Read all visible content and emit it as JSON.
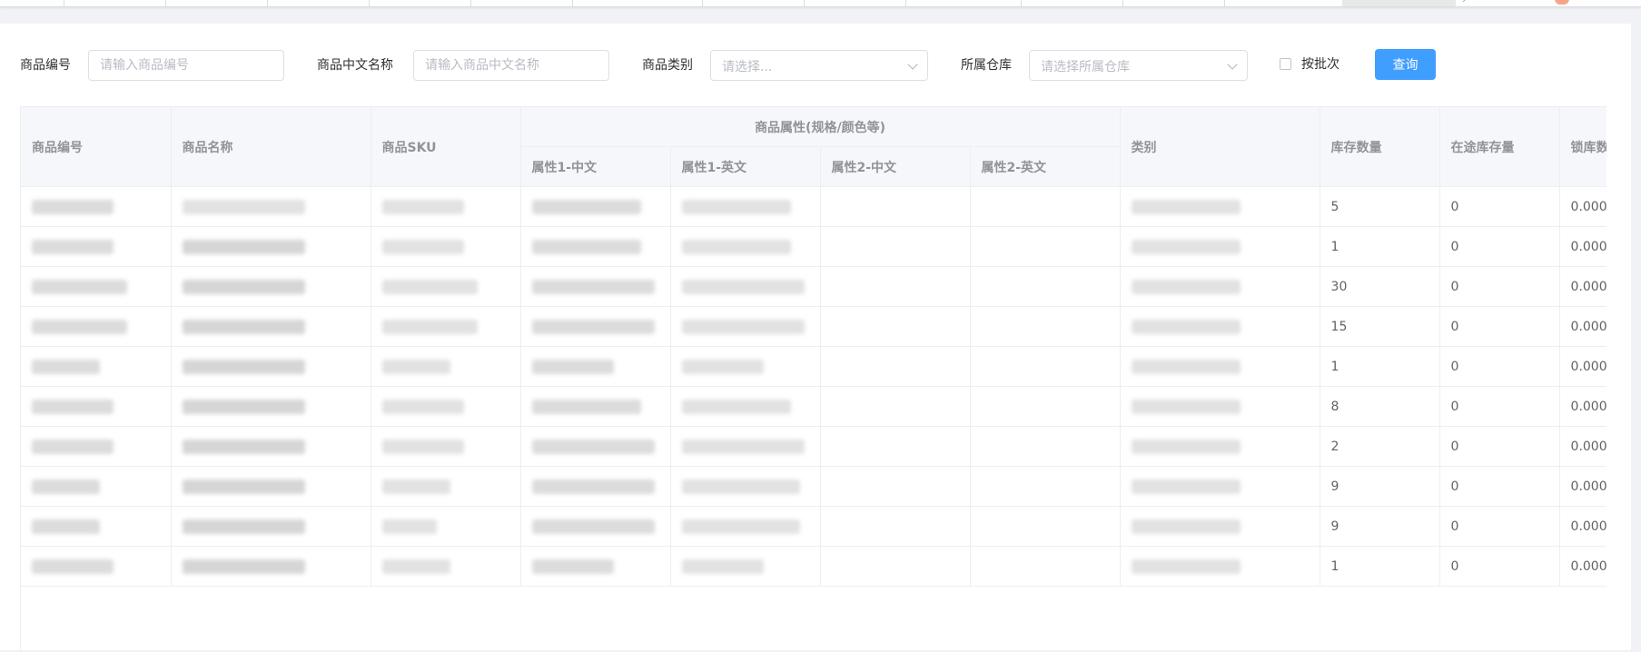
{
  "filters": {
    "product_code_label": "商品编号",
    "product_code_placeholder": "请输入商品编号",
    "cn_name_label": "商品中文名称",
    "cn_name_placeholder": "请输入商品中文名称",
    "category_label": "商品类别",
    "category_placeholder": "请选择...",
    "warehouse_label": "所属仓库",
    "warehouse_placeholder": "请选择所属仓库",
    "batch_label": "按批次",
    "query_button": "查询"
  },
  "table": {
    "headers": {
      "code": "商品编号",
      "name": "商品名称",
      "sku": "商品SKU",
      "attr_group": "商品属性(规格/颜色等)",
      "attr1_cn": "属性1-中文",
      "attr1_en": "属性1-英文",
      "attr2_cn": "属性2-中文",
      "attr2_en": "属性2-英文",
      "category": "类别",
      "stock_qty": "库存数量",
      "in_transit": "在途库存量",
      "locked": "锁库数"
    },
    "rows": [
      {
        "stock": "5",
        "transit": "0",
        "locked": "0.000"
      },
      {
        "stock": "1",
        "transit": "0",
        "locked": "0.000"
      },
      {
        "stock": "30",
        "transit": "0",
        "locked": "0.000"
      },
      {
        "stock": "15",
        "transit": "0",
        "locked": "0.000"
      },
      {
        "stock": "1",
        "transit": "0",
        "locked": "0.000"
      },
      {
        "stock": "8",
        "transit": "0",
        "locked": "0.000"
      },
      {
        "stock": "2",
        "transit": "0",
        "locked": "0.000"
      },
      {
        "stock": "9",
        "transit": "0",
        "locked": "0.000"
      },
      {
        "stock": "9",
        "transit": "0",
        "locked": "0.000"
      },
      {
        "stock": "1",
        "transit": "0",
        "locked": "0.000"
      }
    ]
  },
  "colors": {
    "primary": "#409eff",
    "header_bg": "#f5f7fa",
    "border": "#ebeef5",
    "redacted": "#dcdcdc"
  }
}
